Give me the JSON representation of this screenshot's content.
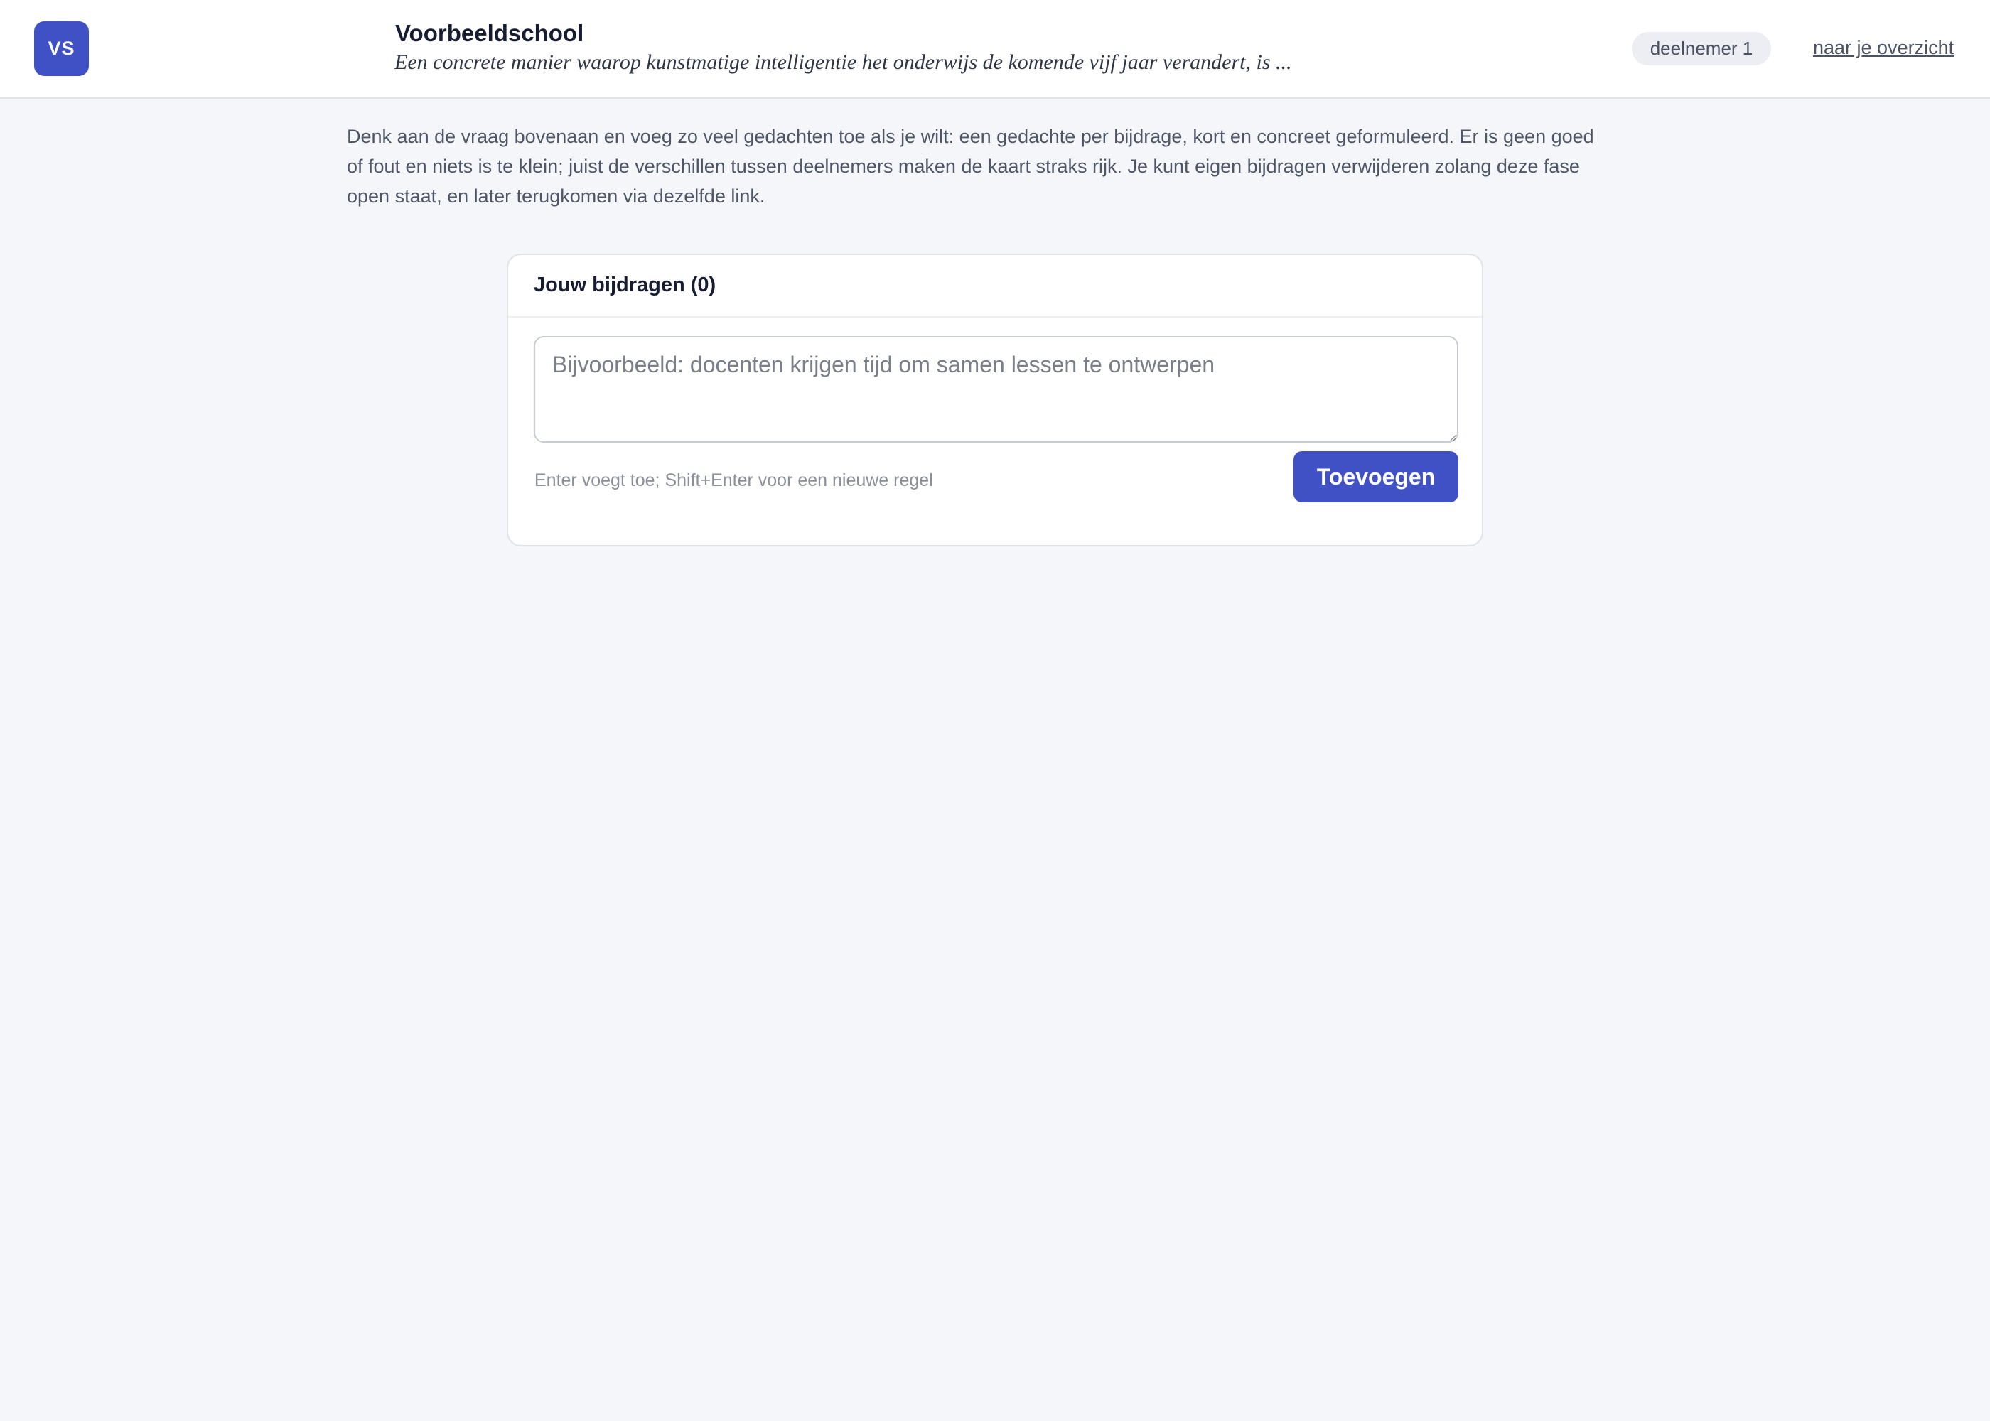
{
  "header": {
    "logo_initials": "VS",
    "school_name": "Voorbeeldschool",
    "question": "Een concrete manier waarop kunstmatige intelligentie het onderwijs de komende vijf jaar verandert, is ...",
    "participant_label": "deelnemer 1",
    "overview_link": "naar je overzicht"
  },
  "main": {
    "instructions": "Denk aan de vraag bovenaan en voeg zo veel gedachten toe als je wilt: een gedachte per bijdrage, kort en concreet geformuleerd. Er is geen goed of fout en niets is te klein; juist de verschillen tussen deelnemers maken de kaart straks rijk. Je kunt eigen bijdragen verwijderen zolang deze fase open staat, en later terugkomen via dezelfde link."
  },
  "contributions": {
    "title": "Jouw bijdragen (0)",
    "input_value": "",
    "input_placeholder": "Bijvoorbeeld: docenten krijgen tijd om samen lessen te ontwerpen",
    "hint": "Enter voegt toe; Shift+Enter voor een nieuwe regel",
    "add_button_label": "Toevoegen"
  },
  "colors": {
    "accent": "#3f51c4",
    "background": "#f4f6fa"
  }
}
